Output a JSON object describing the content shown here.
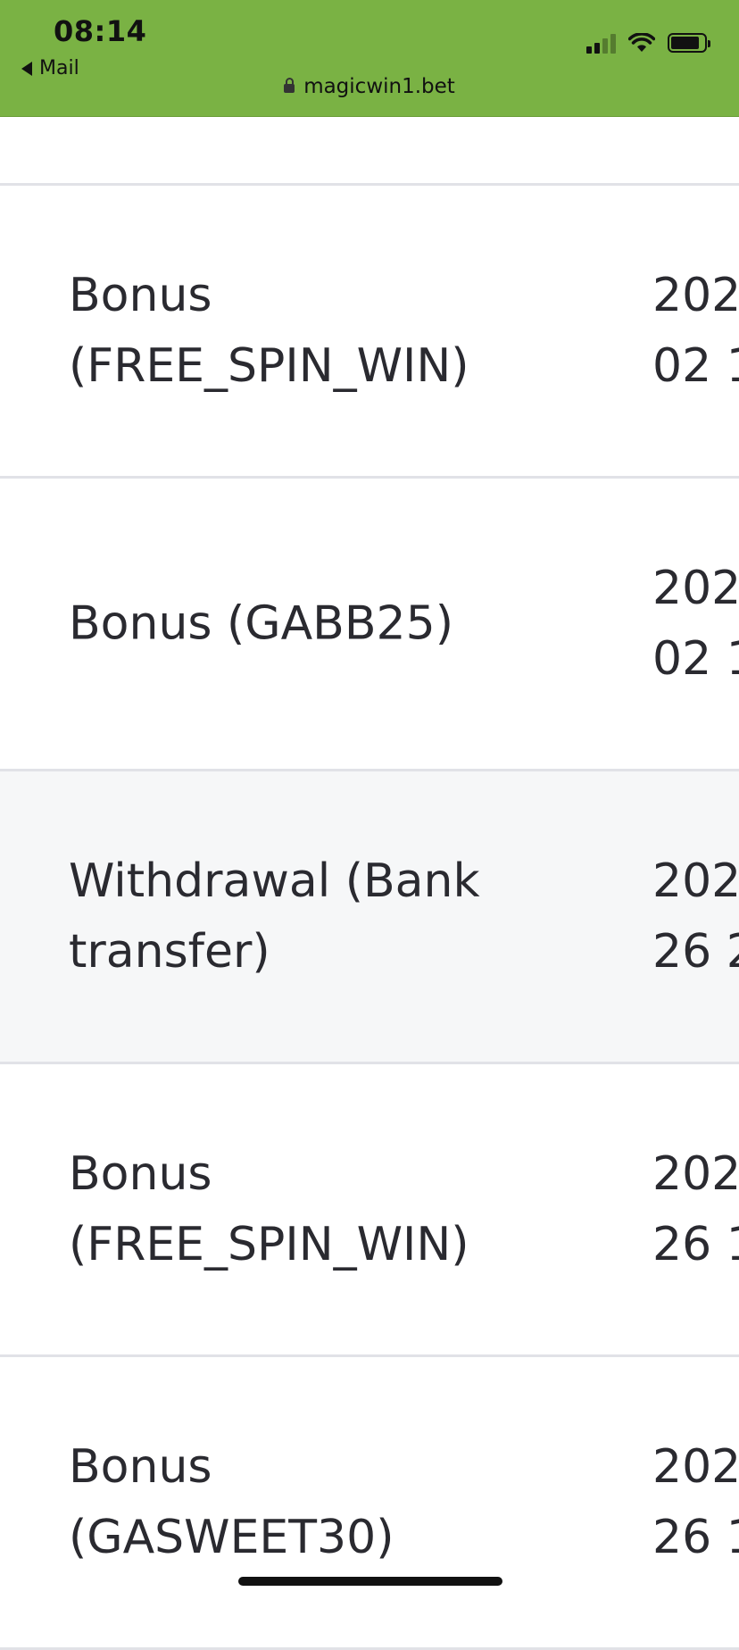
{
  "status_bar": {
    "time": "08:14",
    "back_label": "Mail",
    "url": "magicwin1.bet",
    "background_color": "#7ab244",
    "icons": [
      "signal-icon",
      "wifi-icon",
      "battery-icon",
      "lock-icon"
    ]
  },
  "transactions": [
    {
      "type": "Bonus (FREE_SPIN_WIN)",
      "date": "202\n02 1",
      "highlighted": false
    },
    {
      "type": "Bonus (GABB25)",
      "date": "202\n02 1",
      "highlighted": false
    },
    {
      "type": "Withdrawal (Bank transfer)",
      "date": "202\n26 2",
      "highlighted": true
    },
    {
      "type": "Bonus (FREE_SPIN_WIN)",
      "date": "202\n26 1",
      "highlighted": false
    },
    {
      "type": "Bonus (GASWEET30)",
      "date": "202\n26 1",
      "highlighted": false
    }
  ]
}
